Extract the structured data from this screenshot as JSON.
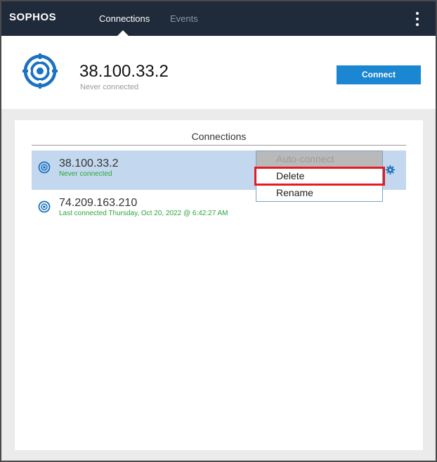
{
  "app": {
    "brand": "SOPHOS",
    "tabs": [
      {
        "label": "Connections",
        "active": true
      },
      {
        "label": "Events",
        "active": false
      }
    ],
    "menu_icon": "kebab-menu-icon"
  },
  "header": {
    "host": "38.100.33.2",
    "status": "Never connected",
    "connect_label": "Connect",
    "icon": "target-icon"
  },
  "connections": {
    "title": "Connections",
    "items": [
      {
        "name": "38.100.33.2",
        "status": "Never connected",
        "selected": true
      },
      {
        "name": "74.209.163.210",
        "status": "Last connected Thursday, Oct 20, 2022 @ 6:42:27 AM",
        "selected": false
      }
    ],
    "context_menu": {
      "items": [
        {
          "label": "Auto-connect",
          "enabled": false
        },
        {
          "label": "Delete",
          "enabled": true,
          "highlighted": true
        },
        {
          "label": "Rename",
          "enabled": true
        }
      ]
    }
  },
  "colors": {
    "topbar": "#1f2b3a",
    "accent": "#1b86d1",
    "selected_row": "#c3d8ee",
    "status_green": "#2ca73a",
    "highlight": "#e31b23"
  }
}
